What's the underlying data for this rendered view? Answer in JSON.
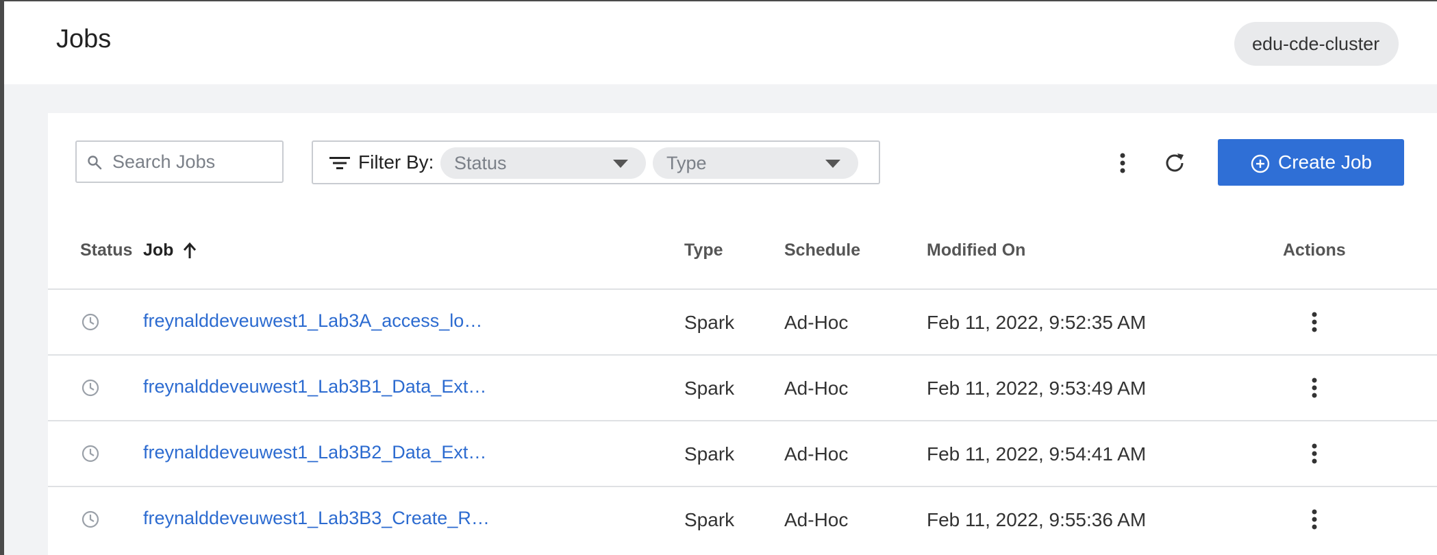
{
  "header": {
    "title": "Jobs",
    "cluster": "edu-cde-cluster"
  },
  "toolbar": {
    "search_placeholder": "Search Jobs",
    "filter_label": "Filter By:",
    "status_placeholder": "Status",
    "type_placeholder": "Type",
    "create_label": "Create Job"
  },
  "table": {
    "columns": {
      "status": "Status",
      "job": "Job",
      "type": "Type",
      "schedule": "Schedule",
      "modified": "Modified On",
      "actions": "Actions"
    },
    "sort": {
      "column": "job",
      "direction": "ascending"
    },
    "rows": [
      {
        "job": "freynalddeveuwest1_Lab3A_access_lo…",
        "type": "Spark",
        "schedule": "Ad-Hoc",
        "modified": "Feb 11, 2022, 9:52:35 AM"
      },
      {
        "job": "freynalddeveuwest1_Lab3B1_Data_Ext…",
        "type": "Spark",
        "schedule": "Ad-Hoc",
        "modified": "Feb 11, 2022, 9:53:49 AM"
      },
      {
        "job": "freynalddeveuwest1_Lab3B2_Data_Ext…",
        "type": "Spark",
        "schedule": "Ad-Hoc",
        "modified": "Feb 11, 2022, 9:54:41 AM"
      },
      {
        "job": "freynalddeveuwest1_Lab3B3_Create_R…",
        "type": "Spark",
        "schedule": "Ad-Hoc",
        "modified": "Feb 11, 2022, 9:55:36 AM"
      }
    ]
  },
  "icons": {
    "search": "search-icon",
    "filter": "filter-icon",
    "more": "kebab-icon",
    "refresh": "refresh-icon",
    "create": "plus-circle-icon",
    "status": "clock-icon",
    "sort": "arrow-up-icon"
  },
  "colors": {
    "accent": "#2f6fd6",
    "link": "#2c6bd0",
    "background": "#f2f3f5"
  }
}
